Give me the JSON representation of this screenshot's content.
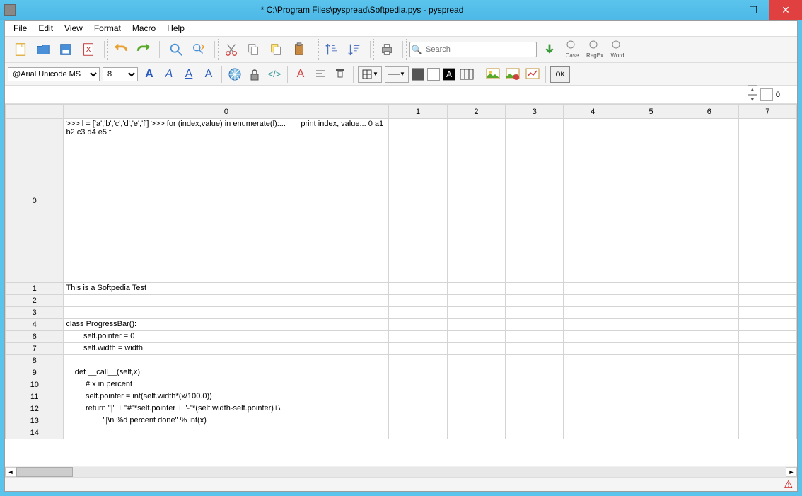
{
  "window": {
    "title": "* C:\\Program Files\\pyspread\\Softpedia.pys - pyspread"
  },
  "menu": {
    "items": [
      "File",
      "Edit",
      "View",
      "Format",
      "Macro",
      "Help"
    ]
  },
  "toolbar": {
    "search_placeholder": "Search",
    "search_labels": {
      "case": "Case",
      "regex": "RegEx",
      "word": "Word"
    }
  },
  "format_bar": {
    "font": "@Arial Unicode MS",
    "size": "8",
    "ok": "OK"
  },
  "tab": {
    "index": "0"
  },
  "columns": [
    "0",
    "1",
    "2",
    "3",
    "4",
    "5",
    "6",
    "7"
  ],
  "rows": [
    {
      "label": "0",
      "cells": [
        ">>> l = ['a','b','c','d','e','f'] >>> for (index,value) in enumerate(l):...       print index, value... 0 a1 b2 c3 d4 e5 f",
        "",
        "",
        "",
        "",
        "",
        "",
        ""
      ],
      "tall": true
    },
    {
      "label": "1",
      "cells": [
        "This is a Softpedia Test",
        "",
        "",
        "",
        "",
        "",
        "",
        ""
      ]
    },
    {
      "label": "2",
      "cells": [
        "",
        "",
        "",
        "",
        "",
        "",
        "",
        ""
      ]
    },
    {
      "label": "3",
      "cells": [
        "",
        "",
        "",
        "",
        "",
        "",
        "",
        ""
      ]
    },
    {
      "label": "4",
      "cells": [
        "class ProgressBar():",
        "",
        "",
        "",
        "",
        "",
        "",
        ""
      ]
    },
    {
      "label": "6",
      "cells": [
        "        self.pointer = 0",
        "",
        "",
        "",
        "",
        "",
        "",
        ""
      ]
    },
    {
      "label": "7",
      "cells": [
        "        self.width = width",
        "",
        "",
        "",
        "",
        "",
        "",
        ""
      ]
    },
    {
      "label": "8",
      "cells": [
        "",
        "",
        "",
        "",
        "",
        "",
        "",
        ""
      ]
    },
    {
      "label": "9",
      "cells": [
        "    def __call__(self,x):",
        "",
        "",
        "",
        "",
        "",
        "",
        ""
      ]
    },
    {
      "label": "10",
      "cells": [
        "         # x in percent",
        "",
        "",
        "",
        "",
        "",
        "",
        ""
      ]
    },
    {
      "label": "11",
      "cells": [
        "         self.pointer = int(self.width*(x/100.0))",
        "",
        "",
        "",
        "",
        "",
        "",
        ""
      ]
    },
    {
      "label": "12",
      "cells": [
        "         return \"|\" + \"#\"*self.pointer + \"-\"*(self.width-self.pointer)+\\",
        "",
        "",
        "",
        "",
        "",
        "",
        ""
      ]
    },
    {
      "label": "13",
      "cells": [
        "                 \"|\\n %d percent done\" % int(x)",
        "",
        "",
        "",
        "",
        "",
        "",
        ""
      ]
    },
    {
      "label": "14",
      "cells": [
        "",
        "",
        "",
        "",
        "",
        "",
        "",
        ""
      ]
    }
  ]
}
